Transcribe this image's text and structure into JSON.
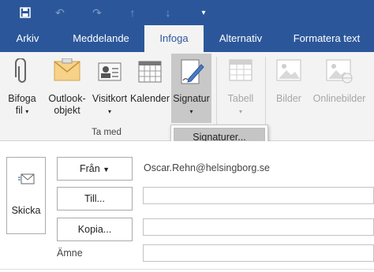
{
  "qat": {
    "icons": [
      "save-icon",
      "undo-icon",
      "redo-icon",
      "up-arrow-icon",
      "down-arrow-icon",
      "customize-icon"
    ]
  },
  "tabs": [
    {
      "label": "Arkiv"
    },
    {
      "label": "Meddelande"
    },
    {
      "label": "Infoga"
    },
    {
      "label": "Alternativ"
    },
    {
      "label": "Formatera text"
    }
  ],
  "ribbon": {
    "attach": {
      "line1": "Bifoga",
      "line2": "fil",
      "icon": "paperclip-icon"
    },
    "outlook_item": {
      "line1": "Outlook-",
      "line2": "objekt",
      "icon": "envelope-icon"
    },
    "business_card": {
      "line1": "Visitkort",
      "icon": "business-card-icon"
    },
    "calendar": {
      "line1": "Kalender",
      "icon": "calendar-icon"
    },
    "signature": {
      "line1": "Signatur",
      "icon": "signature-icon"
    },
    "table": {
      "line1": "Tabell",
      "icon": "table-icon"
    },
    "pictures": {
      "line1": "Bilder",
      "icon": "picture-icon"
    },
    "online_pictures": {
      "line1": "Onlinebilder",
      "icon": "online-picture-icon"
    },
    "group_label": "Ta med"
  },
  "dropdown": {
    "item": "Signaturer..."
  },
  "compose": {
    "send": "Skicka",
    "from_button": "Från",
    "from_value": "Oscar.Rehn@helsingborg.se",
    "to_button": "Till...",
    "cc_button": "Kopia...",
    "subject_label": "Ämne"
  },
  "colors": {
    "brand": "#2b579a",
    "ribbon_bg": "#f3f3f3"
  }
}
